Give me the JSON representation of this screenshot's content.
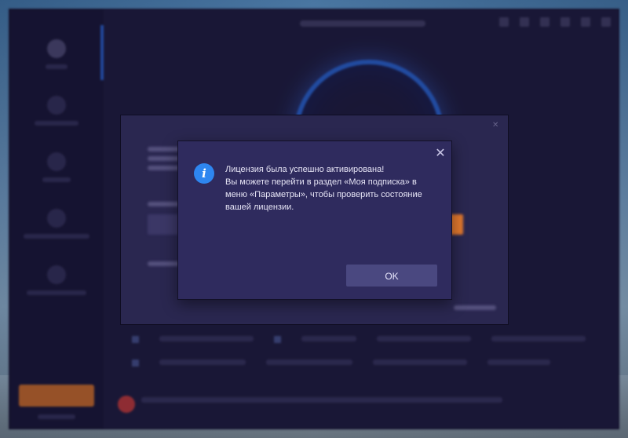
{
  "dialog": {
    "close_glyph": "✕",
    "icon": "info-icon",
    "icon_glyph": "i",
    "message_lines": [
      "Лицензия была успешно активирована!",
      "Вы можете перейти в раздел «Моя подписка» в",
      "меню «Параметры», чтобы проверить состояние",
      "вашей лицензии."
    ],
    "ok_label": "OK"
  },
  "colors": {
    "app_background": "#232044",
    "dialog_background": "#2f2b5e",
    "info_icon": "#2e86f0",
    "ok_button": "#4a4880",
    "accent_orange": "#e2782e",
    "accent_blue": "#2f6fe6"
  }
}
